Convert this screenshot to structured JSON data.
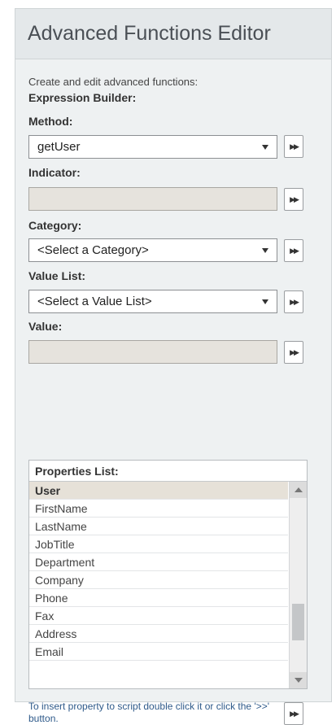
{
  "title": "Advanced Functions Editor",
  "description": "Create and edit advanced functions:",
  "section_label": "Expression Builder:",
  "method": {
    "label": "Method:",
    "value": "getUser"
  },
  "indicator": {
    "label": "Indicator:",
    "value": ""
  },
  "category": {
    "label": "Category:",
    "value": "<Select a Category>"
  },
  "value_list": {
    "label": "Value List:",
    "value": "<Select a Value List>"
  },
  "value": {
    "label": "Value:",
    "value": ""
  },
  "insert_button_label": "▶▶",
  "properties": {
    "title": "Properties List:",
    "selected": "User",
    "items": [
      "FirstName",
      "LastName",
      "JobTitle",
      "Department",
      "Company",
      "Phone",
      "Fax",
      "Address",
      "Email"
    ]
  },
  "hint_text": "To insert property to script double click it or click the '>>' button."
}
